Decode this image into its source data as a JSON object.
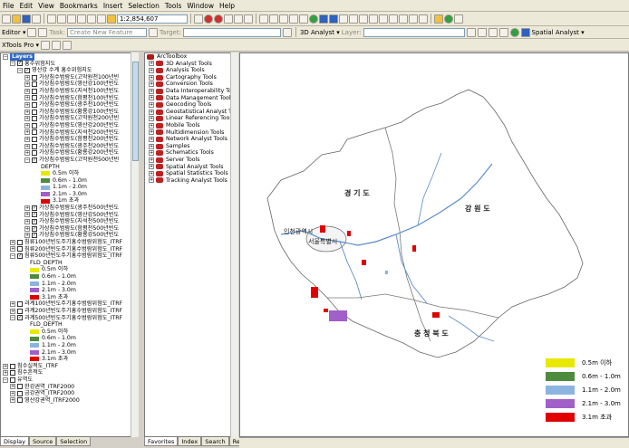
{
  "menu": [
    "File",
    "Edit",
    "View",
    "Bookmarks",
    "Insert",
    "Selection",
    "Tools",
    "Window",
    "Help"
  ],
  "toolbar": {
    "scale": "1:2,854,607",
    "editor_label": "Editor ▾",
    "task_label": "Task:",
    "task_value": "Create New Feature",
    "target_label": "Target:",
    "analyst_label": "3D Analyst ▾",
    "layer_label": "Layer:",
    "spatial_analyst": "Spatial Analyst ▾",
    "xtools": "XTools Pro ▾"
  },
  "toc": {
    "root": "Layers",
    "rows": [
      {
        "indent": 1,
        "exp": "−",
        "chk": "✓",
        "text": "홍수위험지도"
      },
      {
        "indent": 2,
        "exp": "−",
        "chk": "✓",
        "text": "영산강 수계 홍수위험지도"
      },
      {
        "indent": 3,
        "exp": "+",
        "chk": "",
        "text": "가상침수범람도(고막원천100년빈"
      },
      {
        "indent": 3,
        "exp": "+",
        "chk": "",
        "text": "가상침수범람도(영산강100년빈도"
      },
      {
        "indent": 3,
        "exp": "+",
        "chk": "",
        "text": "가상침수범람도(지석천100년빈도"
      },
      {
        "indent": 3,
        "exp": "+",
        "chk": "",
        "text": "가상침수범람도(함평천100년빈도"
      },
      {
        "indent": 3,
        "exp": "+",
        "chk": "",
        "text": "가상침수범람도(광주천100년빈도"
      },
      {
        "indent": 3,
        "exp": "+",
        "chk": "",
        "text": "가상침수범람도(황룡강100년빈도"
      },
      {
        "indent": 3,
        "exp": "+",
        "chk": "",
        "text": "가상침수범람도(고막원천200년빈"
      },
      {
        "indent": 3,
        "exp": "+",
        "chk": "",
        "text": "가상침수범람도(영산강200년빈도"
      },
      {
        "indent": 3,
        "exp": "+",
        "chk": "",
        "text": "가상침수범람도(지석천200년빈도"
      },
      {
        "indent": 3,
        "exp": "+",
        "chk": "",
        "text": "가상침수범람도(함평천200년빈도"
      },
      {
        "indent": 3,
        "exp": "+",
        "chk": "",
        "text": "가상침수범람도(광주천200년빈도"
      },
      {
        "indent": 3,
        "exp": "+",
        "chk": "",
        "text": "가상침수범람도(황룡강200년빈도"
      },
      {
        "indent": 3,
        "exp": "−",
        "chk": "✓",
        "text": "가상침수범람도(고막원천500년빈"
      }
    ],
    "legend1_title": "DEPTH",
    "legend1": [
      {
        "color": "#e8e800",
        "text": "0.5m 이하"
      },
      {
        "color": "#4c8c3c",
        "text": "0.6m - 1.0m"
      },
      {
        "color": "#8cb4e0",
        "text": "1.1m - 2.0m"
      },
      {
        "color": "#a060c8",
        "text": "2.1m - 3.0m"
      },
      {
        "color": "#e00000",
        "text": "3.1m 초과"
      }
    ],
    "rows2": [
      {
        "indent": 3,
        "exp": "+",
        "chk": "✓",
        "text": "가상침수범람도(광주천500년빈도"
      },
      {
        "indent": 3,
        "exp": "+",
        "chk": "✓",
        "text": "가상침수범람도(영산강500년빈도"
      },
      {
        "indent": 3,
        "exp": "+",
        "chk": "✓",
        "text": "가상침수범람도(지석천500년빈도"
      },
      {
        "indent": 3,
        "exp": "+",
        "chk": "✓",
        "text": "가상침수범람도(함평천500년빈도"
      },
      {
        "indent": 3,
        "exp": "+",
        "chk": "✓",
        "text": "가상침수범람도(황룡강500년빈도"
      },
      {
        "indent": 1,
        "exp": "+",
        "chk": "",
        "text": "침류100년빈도주기홍수범람위험도_ITRF"
      },
      {
        "indent": 1,
        "exp": "+",
        "chk": "",
        "text": "침류200년빈도주기홍수범람위험도_ITRF"
      },
      {
        "indent": 1,
        "exp": "−",
        "chk": "✓",
        "text": "침류500년빈도주기홍수범람위험도_ITRF"
      }
    ],
    "legend2_title": "FLD_DEPTH",
    "legend2": [
      {
        "color": "#e8e800",
        "text": "0.5m 이하"
      },
      {
        "color": "#4c8c3c",
        "text": "0.6m - 1.0m"
      },
      {
        "color": "#8cb4e0",
        "text": "1.1m - 2.0m"
      },
      {
        "color": "#a060c8",
        "text": "2.1m - 3.0m"
      },
      {
        "color": "#e00000",
        "text": "3.1m 초과"
      }
    ],
    "rows3": [
      {
        "indent": 1,
        "exp": "+",
        "chk": "",
        "text": "과계100년빈도주기홍수범람위험도_ITRF"
      },
      {
        "indent": 1,
        "exp": "+",
        "chk": "",
        "text": "과계200년빈도주기홍수범람위험도_ITRF"
      },
      {
        "indent": 1,
        "exp": "−",
        "chk": "✓",
        "text": "과계500년빈도주기홍수범람위험도_ITRF"
      }
    ],
    "legend3_title": "FLD_DEPTH",
    "legend3": [
      {
        "color": "#e8e800",
        "text": "0.5m 이하"
      },
      {
        "color": "#4c8c3c",
        "text": "0.6m - 1.0m"
      },
      {
        "color": "#8cb4e0",
        "text": "1.1m - 2.0m"
      },
      {
        "color": "#a060c8",
        "text": "2.1m - 3.0m"
      },
      {
        "color": "#e00000",
        "text": "3.1m 초과"
      }
    ],
    "rows4": [
      {
        "indent": 0,
        "exp": "+",
        "chk": "",
        "text": "침수실적도_ITRF"
      },
      {
        "indent": 0,
        "exp": "+",
        "chk": "",
        "text": "침수흔적도"
      },
      {
        "indent": 0,
        "exp": "−",
        "chk": "",
        "text": "유역도"
      },
      {
        "indent": 1,
        "exp": "+",
        "chk": "",
        "text": "한강권역_ITRF2000"
      },
      {
        "indent": 1,
        "exp": "+",
        "chk": "",
        "text": "금강권역_ITRF2000"
      },
      {
        "indent": 1,
        "exp": "+",
        "chk": "",
        "text": "영산강권역_ITRF2000"
      }
    ],
    "tabs": [
      "Display",
      "Source",
      "Selection"
    ]
  },
  "toolbox": {
    "root": "ArcToolbox",
    "items": [
      "3D Analyst Tools",
      "Analysis Tools",
      "Cartography Tools",
      "Conversion Tools",
      "Data Interoperability Tools",
      "Data Management Tools",
      "Geocoding Tools",
      "Geostatistical Analyst Tools",
      "Linear Referencing Tools",
      "Mobile Tools",
      "Multidimension Tools",
      "Network Analyst Tools",
      "Samples",
      "Schematics Tools",
      "Server Tools",
      "Spatial Analyst Tools",
      "Spatial Statistics Tools",
      "Tracking Analyst Tools"
    ],
    "tabs": [
      "Favorites",
      "Index",
      "Search",
      "Re"
    ]
  },
  "map": {
    "labels": {
      "gyeonggi": "경 기 도",
      "gangwon": "강 원 도",
      "incheon": "인천광역시",
      "seoul": "서울특별시",
      "chungbuk": "충 청 북 도"
    },
    "legend": [
      {
        "color": "#e8e800",
        "text": "0.5m 이하"
      },
      {
        "color": "#4c8c3c",
        "text": "0.6m - 1.0m"
      },
      {
        "color": "#8cb4e0",
        "text": "1.1m - 2.0m"
      },
      {
        "color": "#a060c8",
        "text": "2.1m - 3.0m"
      },
      {
        "color": "#e00000",
        "text": "3.1m 초과"
      }
    ]
  }
}
